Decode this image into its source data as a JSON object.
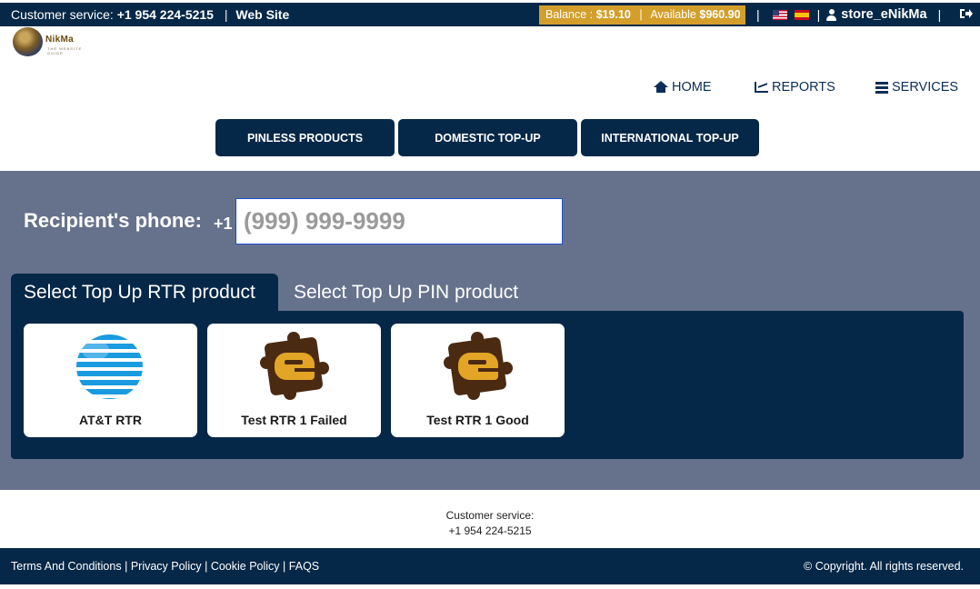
{
  "topbar": {
    "customer_service_label": "Customer service:",
    "customer_service_phone": "+1 954 224-5215",
    "separator": "|",
    "website_label": "Web Site",
    "balance_label": "Balance :",
    "balance_value": "$19.10",
    "available_label": "Available",
    "available_value": "$960.90",
    "flags": [
      "us-flag-icon",
      "es-flag-icon"
    ],
    "username": "store_eNikMa",
    "icons": [
      "user-icon",
      "logout-icon"
    ]
  },
  "logo": {
    "word": "NikMa",
    "tagline": "THE WEBSITE GUIDE"
  },
  "nav": {
    "items": [
      {
        "label": "HOME",
        "icon": "home-icon"
      },
      {
        "label": "REPORTS",
        "icon": "chart-line-icon"
      },
      {
        "label": "SERVICES",
        "icon": "server-icon"
      }
    ]
  },
  "product_tabs": [
    "PINLESS PRODUCTS",
    "DOMESTIC TOP-UP",
    "INTERNATIONAL TOP-UP"
  ],
  "recipient": {
    "label": "Recipient's phone:",
    "prefix": "+1",
    "placeholder": "(999) 999-9999",
    "value": ""
  },
  "select_tabs": {
    "active": "Select Top Up RTR product",
    "inactive": "Select Top Up PIN product"
  },
  "cards": [
    {
      "name": "AT&T RTR",
      "icon": "att-globe-icon"
    },
    {
      "name": "Test RTR 1 Failed",
      "icon": "enikma-puzzle-icon"
    },
    {
      "name": "Test RTR 1 Good",
      "icon": "enikma-puzzle-icon"
    }
  ],
  "footer_cs": {
    "label": "Customer service:",
    "phone": "+1 954 224-5215"
  },
  "footer": {
    "links": [
      "Terms And Conditions",
      "Privacy Policy",
      "Cookie Policy",
      "FAQS"
    ],
    "link_separator": "|",
    "copyright": "© Copyright. All rights reserved."
  },
  "colors": {
    "navy": "#062848",
    "gold": "#d39e2a",
    "slate": "#66728c",
    "att_blue": "#1a9be0",
    "puzzle_brown": "#4b2a12",
    "puzzle_gold": "#e3a526"
  }
}
